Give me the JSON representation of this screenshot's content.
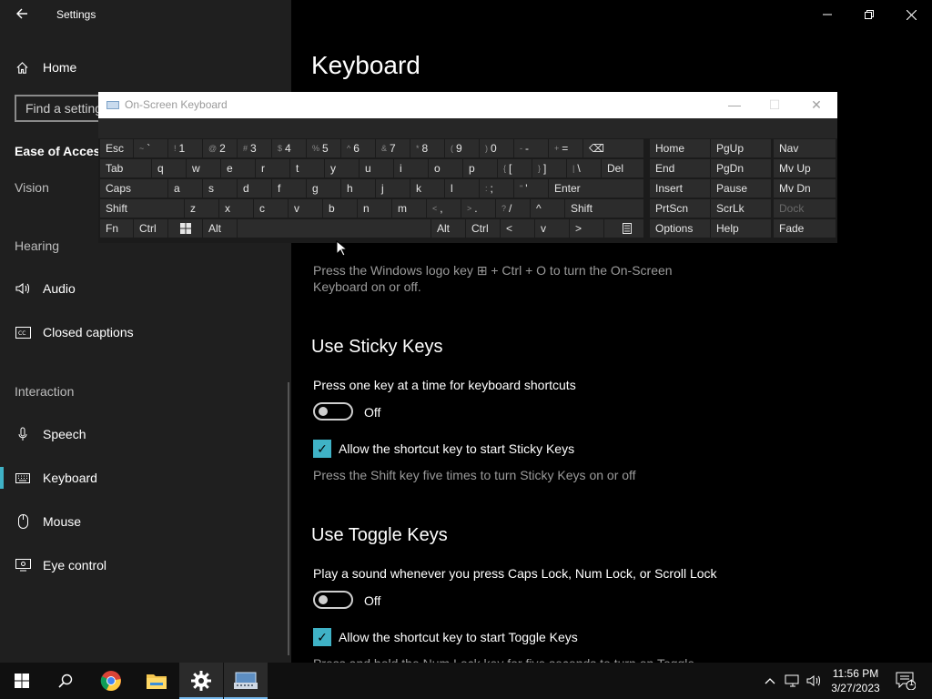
{
  "settings": {
    "app_title": "Settings",
    "home_label": "Home",
    "search_placeholder": "Find a setting",
    "section_title": "Ease of Access",
    "vision_label": "Vision",
    "hearing_label": "Hearing",
    "interaction_label": "Interaction",
    "nav": {
      "audio": "Audio",
      "closed_captions": "Closed captions",
      "speech": "Speech",
      "keyboard": "Keyboard",
      "mouse": "Mouse",
      "eye_control": "Eye control"
    },
    "active_item": "Keyboard"
  },
  "main": {
    "page_title": "Keyboard",
    "osk_hint": "Press the Windows logo key ⊞ + Ctrl + O to turn the On-Screen Keyboard on or off.",
    "sticky": {
      "heading": "Use Sticky Keys",
      "desc": "Press one key at a time for keyboard shortcuts",
      "toggle_state": "Off",
      "checkbox_label": "Allow the shortcut key to start Sticky Keys",
      "hint": "Press the Shift key five times to turn Sticky Keys on or off"
    },
    "toggle_keys": {
      "heading": "Use Toggle Keys",
      "desc": "Play a sound whenever you press Caps Lock, Num Lock, or Scroll Lock",
      "toggle_state": "Off",
      "checkbox_label": "Allow the shortcut key to start Toggle Keys",
      "hint_cut": "Press and hold the Num Lock key for five seconds to turn on Toggle"
    }
  },
  "osk": {
    "title": "On-Screen Keyboard",
    "row1": {
      "esc": "Esc",
      "tilde": "`",
      "tilde_s": "~",
      "k1": "1",
      "k1_s": "!",
      "k2": "2",
      "k2_s": "@",
      "k3": "3",
      "k3_s": "#",
      "k4": "4",
      "k4_s": "$",
      "k5": "5",
      "k5_s": "%",
      "k6": "6",
      "k6_s": "^",
      "k7": "7",
      "k7_s": "&",
      "k8": "8",
      "k8_s": "*",
      "k9": "9",
      "k9_s": "(",
      "k0": "0",
      "k0_s": ")",
      "minus": "-",
      "minus_s": "-",
      "equals": "=",
      "equals_s": "+",
      "backspace": "⌫"
    },
    "row2": {
      "tab": "Tab",
      "q": "q",
      "w": "w",
      "e": "e",
      "r": "r",
      "t": "t",
      "y": "y",
      "u": "u",
      "i": "i",
      "o": "o",
      "p": "p",
      "lbr": "[",
      "lbr_s": "{",
      "rbr": "]",
      "rbr_s": "}",
      "bslash": "\\",
      "bslash_s": "|",
      "del": "Del"
    },
    "row3": {
      "caps": "Caps",
      "a": "a",
      "s": "s",
      "d": "d",
      "f": "f",
      "g": "g",
      "h": "h",
      "j": "j",
      "k": "k",
      "l": "l",
      "semi": ";",
      "semi_s": ":",
      "quote": "'",
      "quote_s": "\"",
      "enter": "Enter"
    },
    "row4": {
      "shift": "Shift",
      "z": "z",
      "x": "x",
      "c": "c",
      "v": "v",
      "b": "b",
      "n": "n",
      "m": "m",
      "comma": ",",
      "comma_s": "<",
      "period": ".",
      "period_s": ">",
      "slash": "/",
      "slash_s": "?",
      "up": "^",
      "shift_r": "Shift"
    },
    "row5": {
      "fn": "Fn",
      "ctrl": "Ctrl",
      "alt": "Alt",
      "alt_r": "Alt",
      "ctrl_r": "Ctrl",
      "left": "<",
      "down": "v",
      "right": ">"
    },
    "nav_keys": {
      "home": "Home",
      "pgup": "PgUp",
      "nav": "Nav",
      "end": "End",
      "pgdn": "PgDn",
      "mvup": "Mv Up",
      "insert": "Insert",
      "pause": "Pause",
      "mvdn": "Mv Dn",
      "prtscn": "PrtScn",
      "scrlk": "ScrLk",
      "dock": "Dock",
      "options": "Options",
      "help": "Help",
      "fade": "Fade"
    }
  },
  "taskbar": {
    "time": "11:56 PM",
    "date": "3/27/2023",
    "notification_count": "1"
  },
  "colors": {
    "accent": "#3fb2c6",
    "sidebar_bg": "#1f1f1f",
    "main_bg": "#000000",
    "key_bg": "#2c2c2c"
  }
}
